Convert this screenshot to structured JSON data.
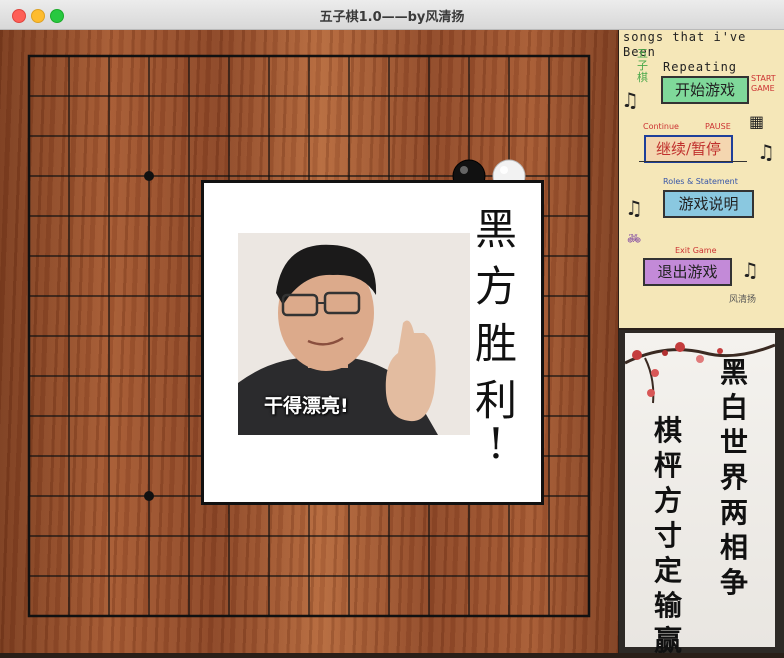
{
  "window": {
    "title": "五子棋1.0——by风清扬"
  },
  "board": {
    "rows": 15,
    "cols": 15,
    "star_points": [
      [
        3,
        3
      ],
      [
        3,
        11
      ],
      [
        11,
        3
      ]
    ],
    "stones": [
      {
        "row": 3,
        "col": 11,
        "color": "black"
      },
      {
        "row": 3,
        "col": 12,
        "color": "white"
      }
    ]
  },
  "result_popup": {
    "verdict_chars": [
      "黑",
      "方",
      "胜",
      "利",
      "!"
    ],
    "caption": "干得漂亮!"
  },
  "menu": {
    "header_line1": "songs that i've Been",
    "header_line2": "Repeating",
    "logo_text": "五子棋",
    "start_label": "开始游戏",
    "start_note": "START GAME",
    "continue_note": "Continue",
    "pause_note": "PAUSE",
    "continue_label": "继续/暂停",
    "help_note": "Roles & Statement",
    "help_label": "游戏说明",
    "exit_note": "Exit Game",
    "exit_label": "退出游戏",
    "signature": "风清扬"
  },
  "poem": {
    "right_column": [
      "黑",
      "白",
      "世",
      "界",
      "两",
      "相",
      "争"
    ],
    "left_column": [
      "棋",
      "枰",
      "方",
      "寸",
      "定",
      "输",
      "赢"
    ]
  },
  "colors": {
    "board_wood": "#9a5030",
    "menu_bg": "#f5e7b8",
    "grid": "#111111"
  }
}
